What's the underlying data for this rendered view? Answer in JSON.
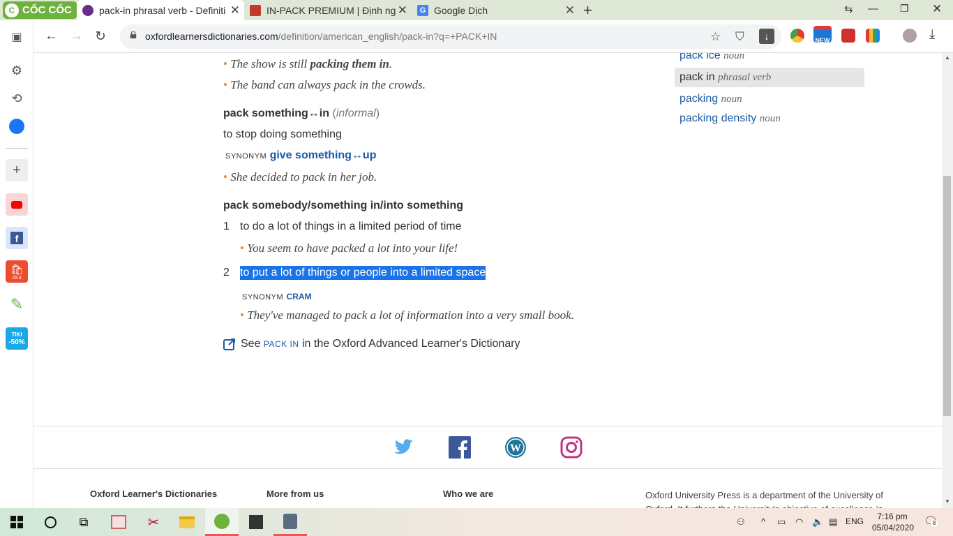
{
  "browser": {
    "brand": "CỐC CỐC",
    "tabs": [
      {
        "title": "pack-in phrasal verb - Definiti"
      },
      {
        "title": "IN-PACK PREMIUM | Định ngh"
      },
      {
        "title": "Google Dịch"
      }
    ],
    "url_host": "oxfordlearnersdictionaries.com",
    "url_path": "/definition/american_english/pack-in?q=+PACK+IN",
    "ext_badge": "NEW"
  },
  "sidebar": {
    "shopee_badge": "28.4",
    "tiki_label": "TIKI",
    "tiki_badge": "-50%"
  },
  "entry": {
    "ex1_pre": "The show is still ",
    "ex1_bold": "packing them in",
    "ex1_post": ".",
    "ex2": "The band can always pack in the crowds.",
    "sense1_head": "pack something↔in",
    "sense1_paren_open": " (",
    "sense1_label": "informal",
    "sense1_paren_close": ")",
    "sense1_def": "to stop doing something",
    "synonym_label": "SYNONYM",
    "sense1_syn": "give something↔up",
    "sense1_ex": "She decided to pack in her job.",
    "sense2_head": "pack somebody/something in/into something",
    "num1": "1",
    "def1": "to do a lot of things in a limited period of time",
    "ex3": "You seem to have packed a lot into your life!",
    "num2": "2",
    "def2": "to put a lot of things or people into a limited space",
    "syn2": "CRAM",
    "ex4": "They've managed to pack a lot of information into a very small book.",
    "see_pre": "See ",
    "see_link": "PACK IN",
    "see_post": " in the Oxford Advanced Learner's Dictionary"
  },
  "related": [
    {
      "word": "pack ice",
      "pos": "noun"
    },
    {
      "word": "pack in",
      "pos": "phrasal verb"
    },
    {
      "word": "packing",
      "pos": "noun"
    },
    {
      "word": "packing density",
      "pos": "noun"
    }
  ],
  "footer": {
    "col1": "Oxford Learner's Dictionaries",
    "col2": "More from us",
    "col3": "Who we are",
    "about": "Oxford University Press is a department of the University of Oxford. It furthers the University's objective of excellence in"
  },
  "taskbar": {
    "lang": "ENG",
    "time": "7:16 pm",
    "date": "05/04/2020",
    "notif_count": "8"
  },
  "colors": {
    "accent": "#6eb23e",
    "link": "#1b5aa6",
    "selection": "#1a73e8"
  }
}
